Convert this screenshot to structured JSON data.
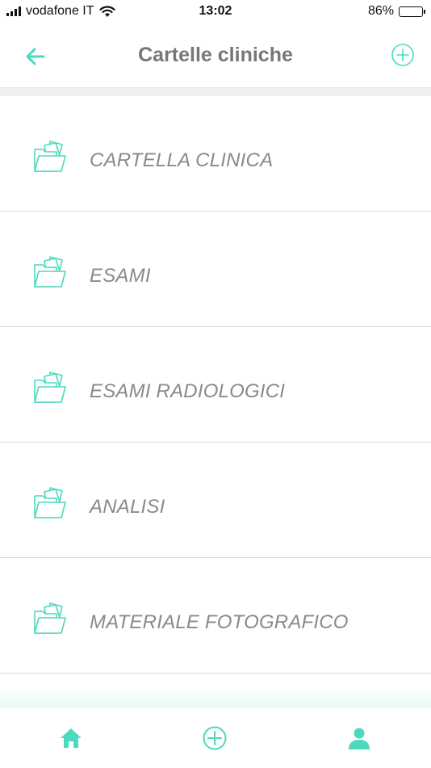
{
  "status_bar": {
    "carrier": "vodafone IT",
    "time": "13:02",
    "battery": "86%",
    "battery_level": 0.86
  },
  "header": {
    "title": "Cartelle cliniche",
    "back_icon": "arrow-left-icon",
    "add_icon": "plus-circle-icon"
  },
  "items": [
    {
      "label": "CARTELLA CLINICA",
      "icon": "folder-icon"
    },
    {
      "label": "ESAMI",
      "icon": "folder-icon"
    },
    {
      "label": "ESAMI RADIOLOGICI",
      "icon": "folder-icon"
    },
    {
      "label": "ANALISI",
      "icon": "folder-icon"
    },
    {
      "label": "MATERIALE FOTOGRAFICO",
      "icon": "folder-icon"
    }
  ],
  "tab_bar": {
    "tabs": [
      {
        "icon": "home-icon"
      },
      {
        "icon": "plus-circle-icon"
      },
      {
        "icon": "user-icon"
      }
    ]
  },
  "colors": {
    "accent": "#4cd9bd",
    "title": "#777777",
    "item_text": "#8a8a8a",
    "divider": "#d7d7d7"
  }
}
